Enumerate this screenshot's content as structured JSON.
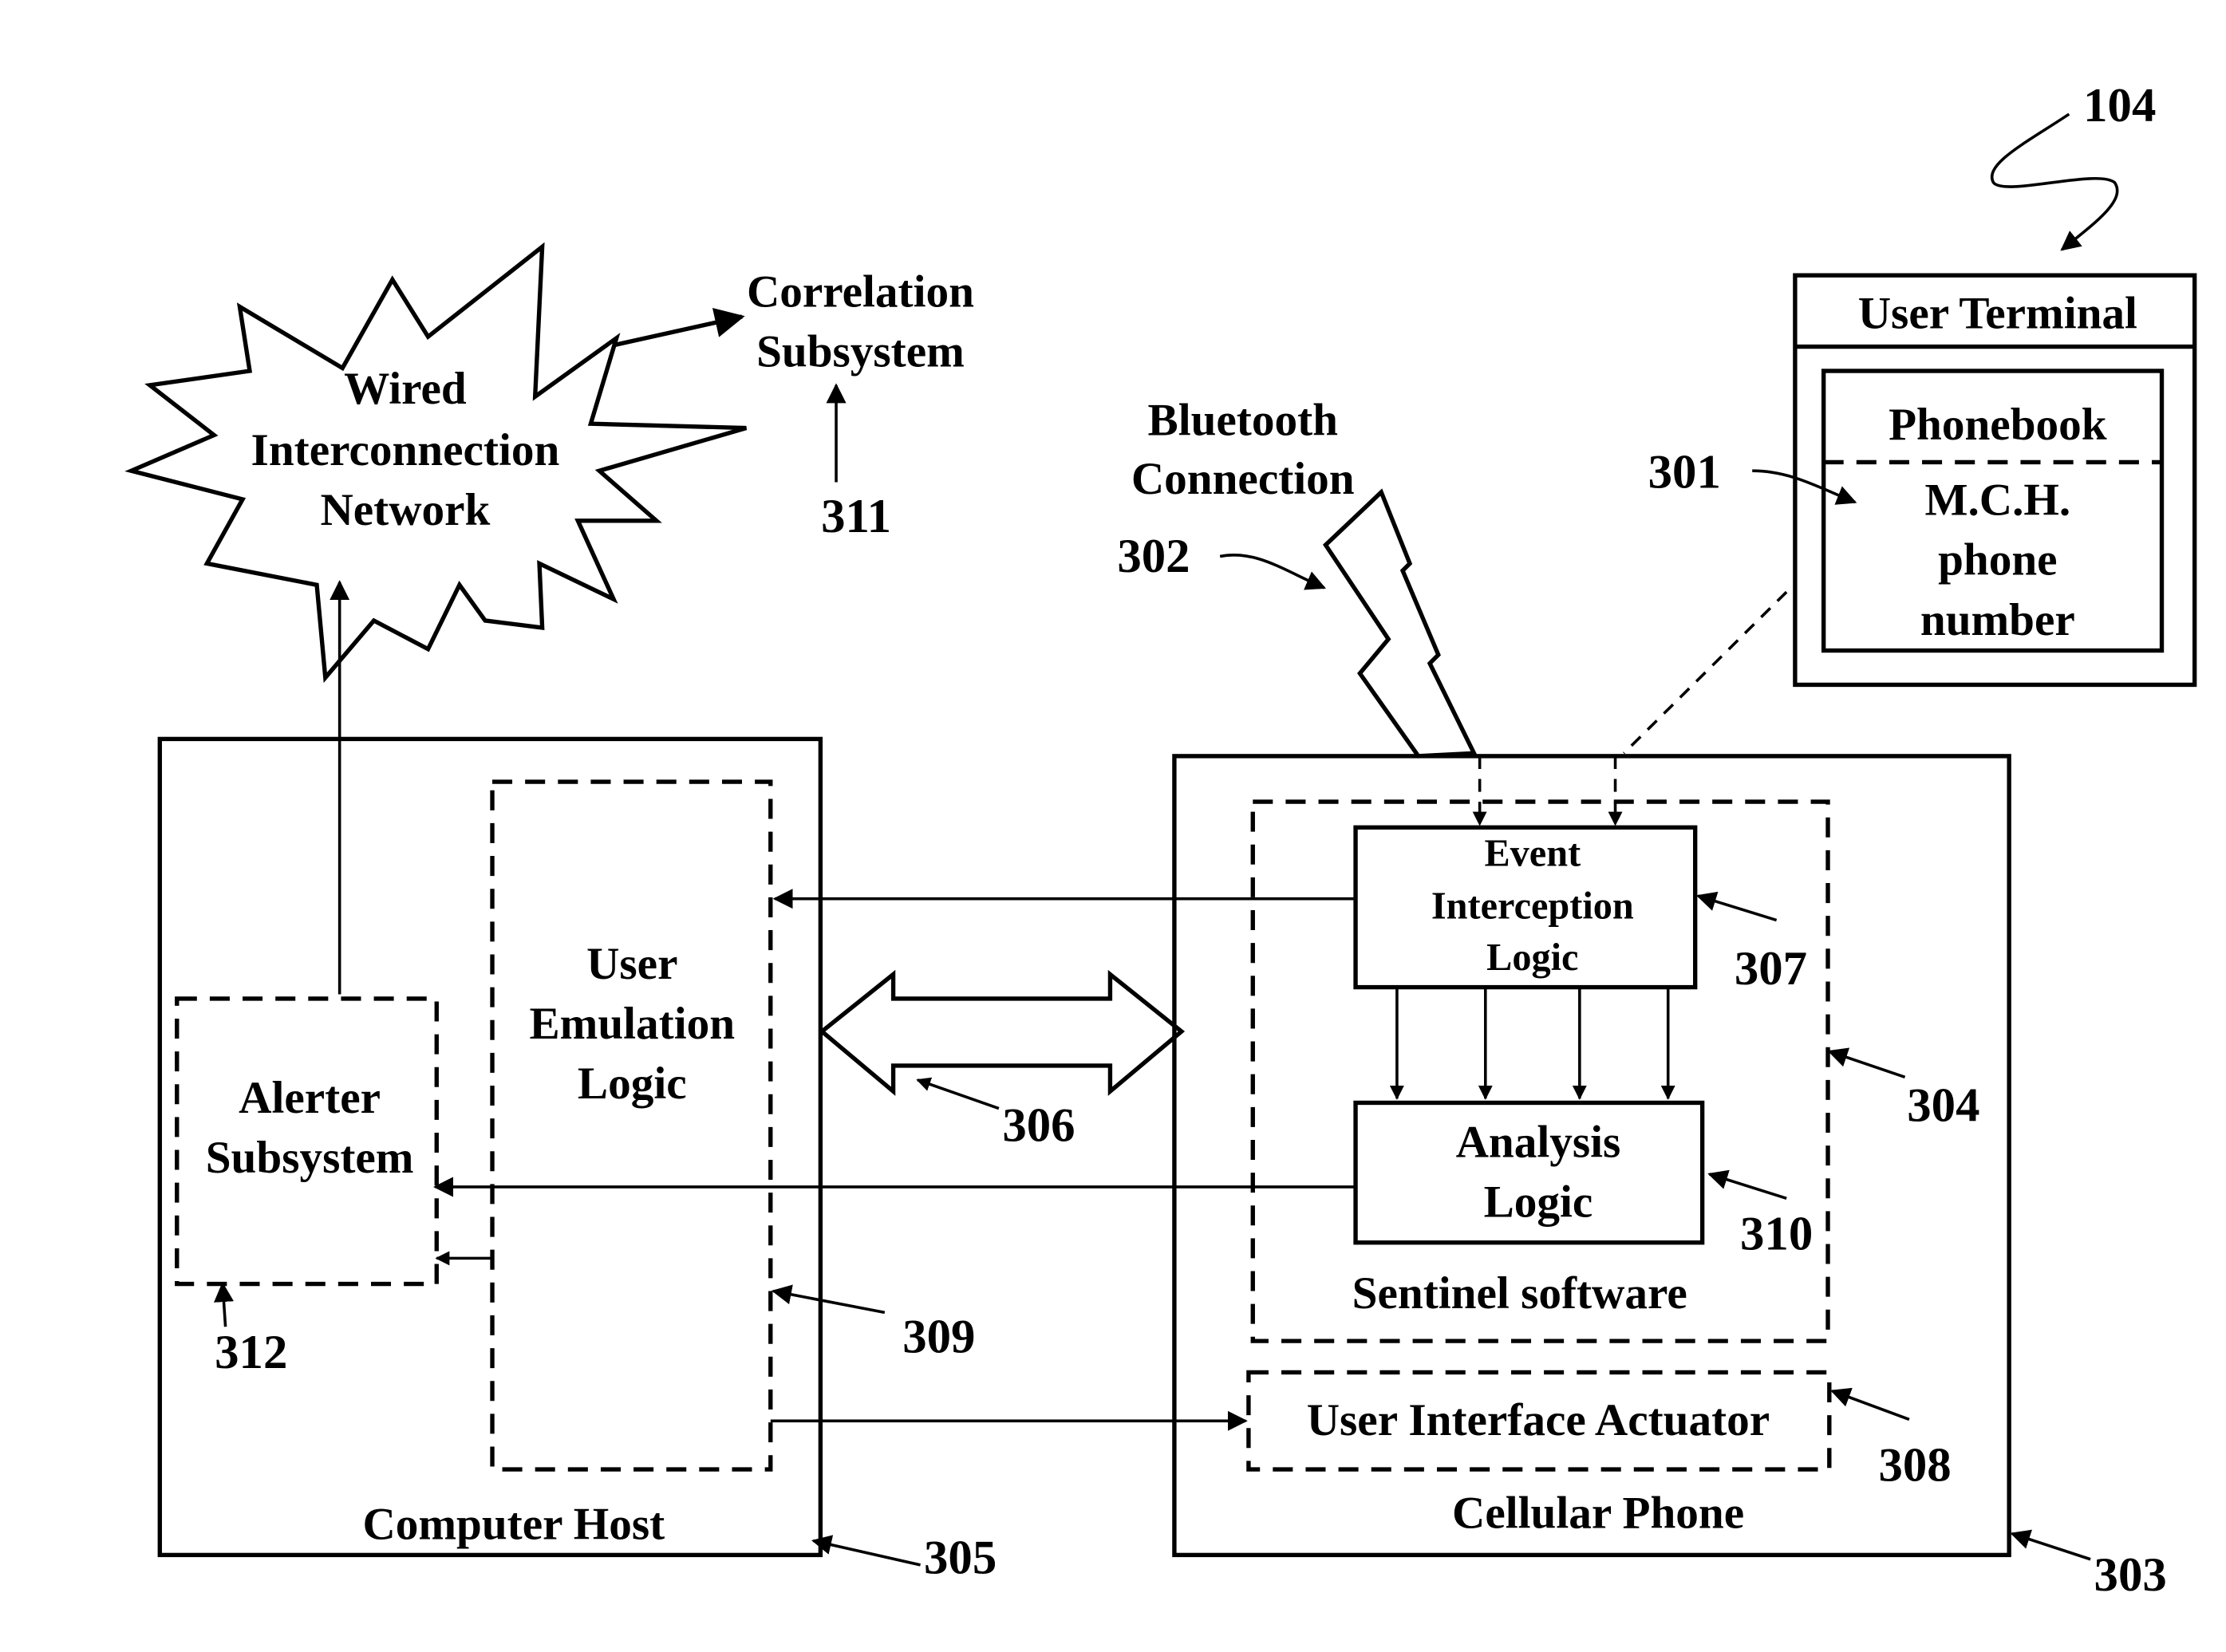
{
  "figure": {
    "ref_user_terminal_system": "104",
    "cloud": {
      "lines": [
        "Wired",
        "Interconnection",
        "Network"
      ]
    },
    "correlation": {
      "lines": [
        "Correlation",
        "Subsystem"
      ],
      "ref": "311"
    },
    "bluetooth": {
      "lines": [
        "Bluetooth",
        "Connection"
      ],
      "ref": "302"
    },
    "user_terminal": {
      "title": "User Terminal",
      "phonebook_label": "Phonebook",
      "entry_lines": [
        "M.C.H.",
        "phone",
        "number"
      ],
      "entry_ref": "301"
    },
    "computer_host": {
      "label": "Computer Host",
      "ref": "305",
      "alerter": {
        "lines": [
          "Alerter",
          "Subsystem"
        ],
        "ref": "312"
      },
      "user_emulation": {
        "lines": [
          "User",
          "Emulation",
          "Logic"
        ],
        "ref": "309"
      }
    },
    "link_ref": "306",
    "cellular_phone": {
      "label": "Cellular Phone",
      "ref": "303",
      "sentinel": {
        "label": "Sentinel software",
        "ref": "304",
        "event_interception": {
          "lines": [
            "Event",
            "Interception",
            "Logic"
          ],
          "ref": "307"
        },
        "analysis": {
          "lines": [
            "Analysis",
            "Logic"
          ],
          "ref": "310"
        }
      },
      "ui_actuator": {
        "label": "User Interface Actuator",
        "ref": "308"
      }
    }
  }
}
